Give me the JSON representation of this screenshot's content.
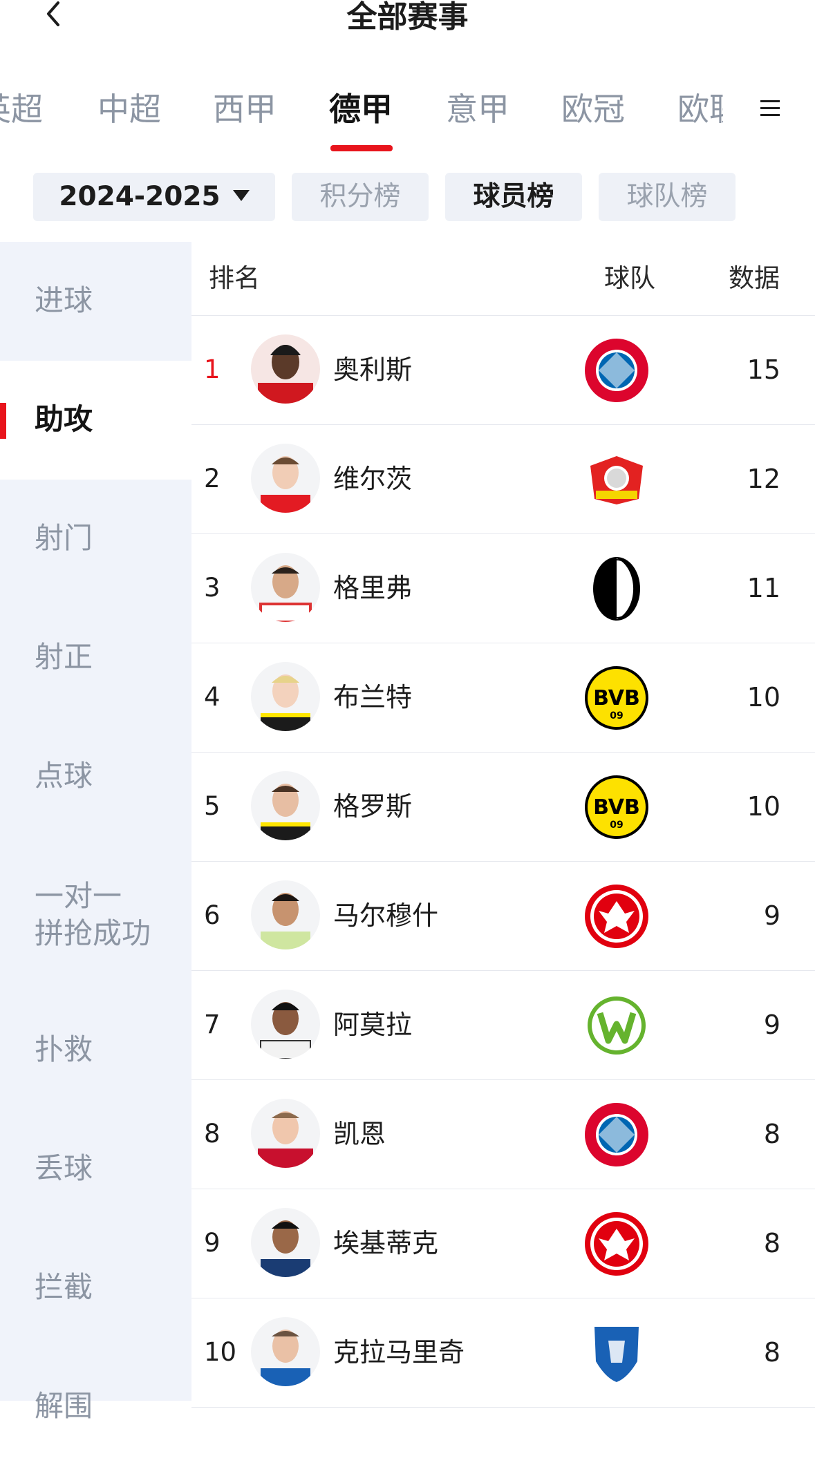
{
  "header": {
    "title": "全部赛事"
  },
  "league_tabs": [
    "英超",
    "中超",
    "西甲",
    "德甲",
    "意甲",
    "欧冠",
    "欧联"
  ],
  "filters": {
    "season": "2024-2025",
    "standings": "积分榜",
    "players": "球员榜",
    "teams": "球队榜"
  },
  "sidebar": {
    "items": [
      {
        "label": "进球"
      },
      {
        "label": "助攻"
      },
      {
        "label": "射门"
      },
      {
        "label": "射正"
      },
      {
        "label": "点球"
      },
      {
        "label": "一对一\n拼抢成功"
      },
      {
        "label": "扑救"
      },
      {
        "label": "丢球"
      },
      {
        "label": "拦截"
      },
      {
        "label": "解围"
      }
    ]
  },
  "table": {
    "headers": {
      "rank": "排名",
      "team": "球队",
      "data": "数据"
    },
    "rows": [
      {
        "rank": "1",
        "name": "奥利斯",
        "team": "bayern",
        "value": "15"
      },
      {
        "rank": "2",
        "name": "维尔茨",
        "team": "leverkusen",
        "value": "12"
      },
      {
        "rank": "3",
        "name": "格里弗",
        "team": "freiburg",
        "value": "11"
      },
      {
        "rank": "4",
        "name": "布兰特",
        "team": "dortmund",
        "value": "10"
      },
      {
        "rank": "5",
        "name": "格罗斯",
        "team": "dortmund",
        "value": "10"
      },
      {
        "rank": "6",
        "name": "马尔穆什",
        "team": "frankfurt",
        "value": "9"
      },
      {
        "rank": "7",
        "name": "阿莫拉",
        "team": "wolfsburg",
        "value": "9"
      },
      {
        "rank": "8",
        "name": "凯恩",
        "team": "bayern",
        "value": "8"
      },
      {
        "rank": "9",
        "name": "埃基蒂克",
        "team": "frankfurt",
        "value": "8"
      },
      {
        "rank": "10",
        "name": "克拉马里奇",
        "team": "hoffenheim",
        "value": "8"
      }
    ]
  },
  "colors": {
    "accent": "#e8141c",
    "sidebar_bg": "#f0f3fa",
    "inactive_text": "#8c95a3"
  }
}
